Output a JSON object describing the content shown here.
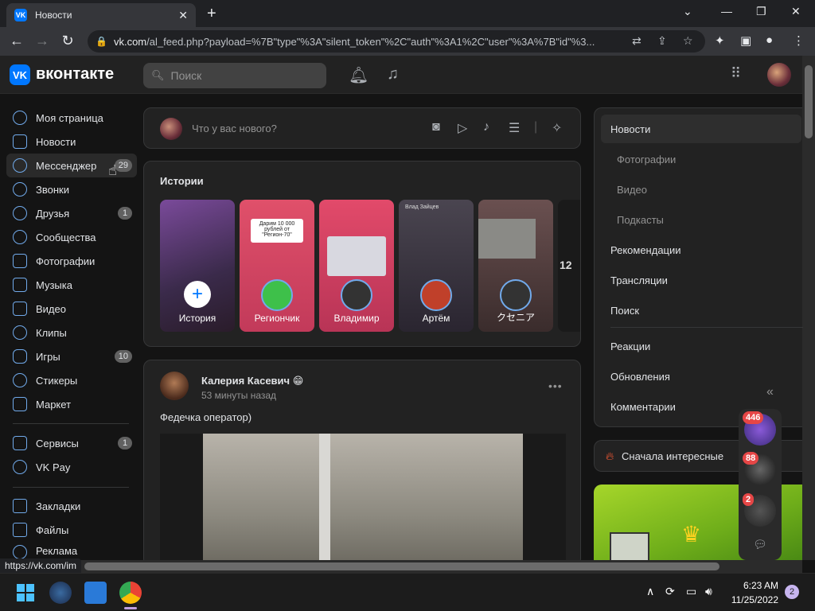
{
  "browser": {
    "tab_title": "Новости",
    "tab_favicon": "VK",
    "address_domain": "vk.com",
    "address_path": "/al_feed.php?payload=%7B\"type\"%3A\"silent_token\"%2C\"auth\"%3A1%2C\"user\"%3A%7B\"id\"%3...",
    "status_url": "https://vk.com/im"
  },
  "header": {
    "logo_mark": "VK",
    "logo_text": "вконтакте",
    "search_placeholder": "Поиск"
  },
  "sidebar": {
    "items": [
      {
        "label": "Моя страница",
        "badge": ""
      },
      {
        "label": "Новости",
        "badge": ""
      },
      {
        "label": "Мессенджер",
        "badge": "29"
      },
      {
        "label": "Звонки",
        "badge": ""
      },
      {
        "label": "Друзья",
        "badge": "1"
      },
      {
        "label": "Сообщества",
        "badge": ""
      },
      {
        "label": "Фотографии",
        "badge": ""
      },
      {
        "label": "Музыка",
        "badge": ""
      },
      {
        "label": "Видео",
        "badge": ""
      },
      {
        "label": "Клипы",
        "badge": ""
      },
      {
        "label": "Игры",
        "badge": "10"
      },
      {
        "label": "Стикеры",
        "badge": ""
      },
      {
        "label": "Маркет",
        "badge": ""
      }
    ],
    "items2": [
      {
        "label": "Сервисы",
        "badge": "1"
      },
      {
        "label": "VK Pay",
        "badge": ""
      }
    ],
    "items3": [
      {
        "label": "Закладки"
      },
      {
        "label": "Файлы"
      },
      {
        "label": "Реклама"
      }
    ]
  },
  "composer": {
    "placeholder": "Что у вас нового?"
  },
  "stories": {
    "title": "Истории",
    "items": [
      {
        "label": "История",
        "color": "#3a2a4a"
      },
      {
        "label": "Региончик",
        "color": "#e0506a",
        "text": "Дарим 10 000 рублей от \"Регион-70\""
      },
      {
        "label": "Владимир",
        "color": "#e24a6a"
      },
      {
        "label": "Артём",
        "color": "#3a3540",
        "text": "Влад Зайцев"
      },
      {
        "label": "クセニア",
        "color": "#5a4040"
      },
      {
        "label": "",
        "color": "#1a1a1a",
        "text": "12"
      }
    ]
  },
  "post": {
    "author": "Калерия Касевич",
    "emoji": "😁",
    "time": "53 минуты назад",
    "text": "Федечка оператор)"
  },
  "right_nav": {
    "items": [
      {
        "label": "Новости"
      },
      {
        "label": "Фотографии"
      },
      {
        "label": "Видео"
      },
      {
        "label": "Подкасты"
      },
      {
        "label": "Рекомендации"
      },
      {
        "label": "Трансляции"
      },
      {
        "label": "Поиск"
      }
    ],
    "items2": [
      {
        "label": "Реакции"
      },
      {
        "label": "Обновления"
      },
      {
        "label": "Комментарии"
      }
    ],
    "sort_label": "Сначала интересные"
  },
  "floating_chats": [
    {
      "badge": "446"
    },
    {
      "badge": "88"
    },
    {
      "badge": "2"
    }
  ],
  "taskbar": {
    "time": "6:23 AM",
    "date": "11/25/2022",
    "notif": "2"
  },
  "colors": {
    "accent": "#0077ff",
    "link": "#71aaeb",
    "badge_red": "#e64646"
  }
}
